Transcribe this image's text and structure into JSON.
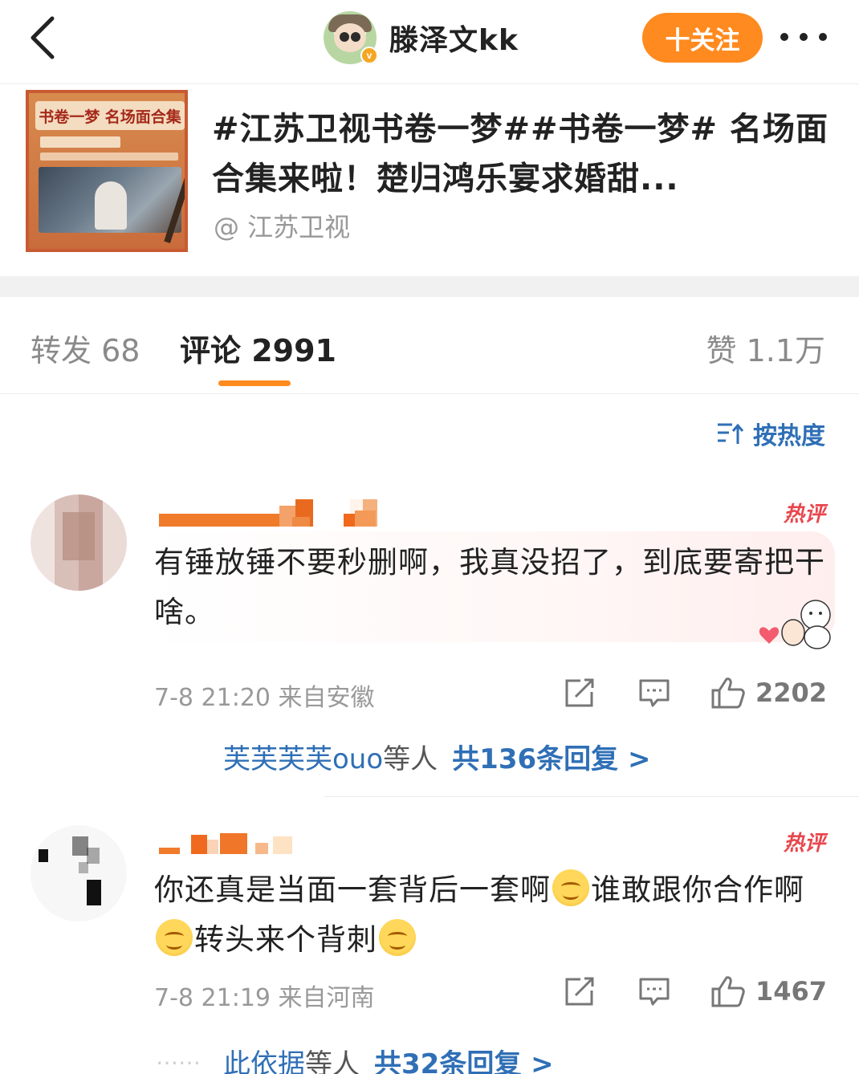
{
  "header": {
    "username": "滕泽文kk",
    "follow_label": "十关注",
    "verified_badge": "v",
    "icons": [
      "back-icon",
      "more-icon"
    ]
  },
  "repost_card": {
    "thumb_banner": "书卷一梦 名场面合集",
    "title": "#江苏卫视书卷一梦##书卷一梦# 名场面合集来啦！楚归鸿乐宴求婚甜...",
    "source": "@ 江苏卫视"
  },
  "tabs": {
    "repost": "转发 68",
    "comment": "评论 2991",
    "like": "赞 1.1万"
  },
  "sort": {
    "label": "按热度"
  },
  "comments": [
    {
      "hot_tag": "热评",
      "text": "有锤放锤不要秒删啊，我真没招了，到底要寄把干啥。",
      "time": "7-8 21:20",
      "location": "来自安徽",
      "likes": "2202",
      "reply_users": "芙芙芙芙ouo",
      "reply_mid": "等人",
      "reply_count": "共136条回复 >"
    },
    {
      "hot_tag": "热评",
      "text_parts": [
        "你还真是当面一套背后一套啊",
        "谁敢跟你合作啊",
        "转头来个背刺",
        ""
      ],
      "time": "7-8 21:19",
      "location": "来自河南",
      "likes": "1467",
      "reply_dots": "……",
      "reply_users": "此依据",
      "reply_mid": "等人",
      "reply_count": "共32条回复 >"
    }
  ],
  "colors": {
    "accent": "#ff8a1f",
    "link": "#2f6fb6",
    "hot": "#e8464d"
  }
}
